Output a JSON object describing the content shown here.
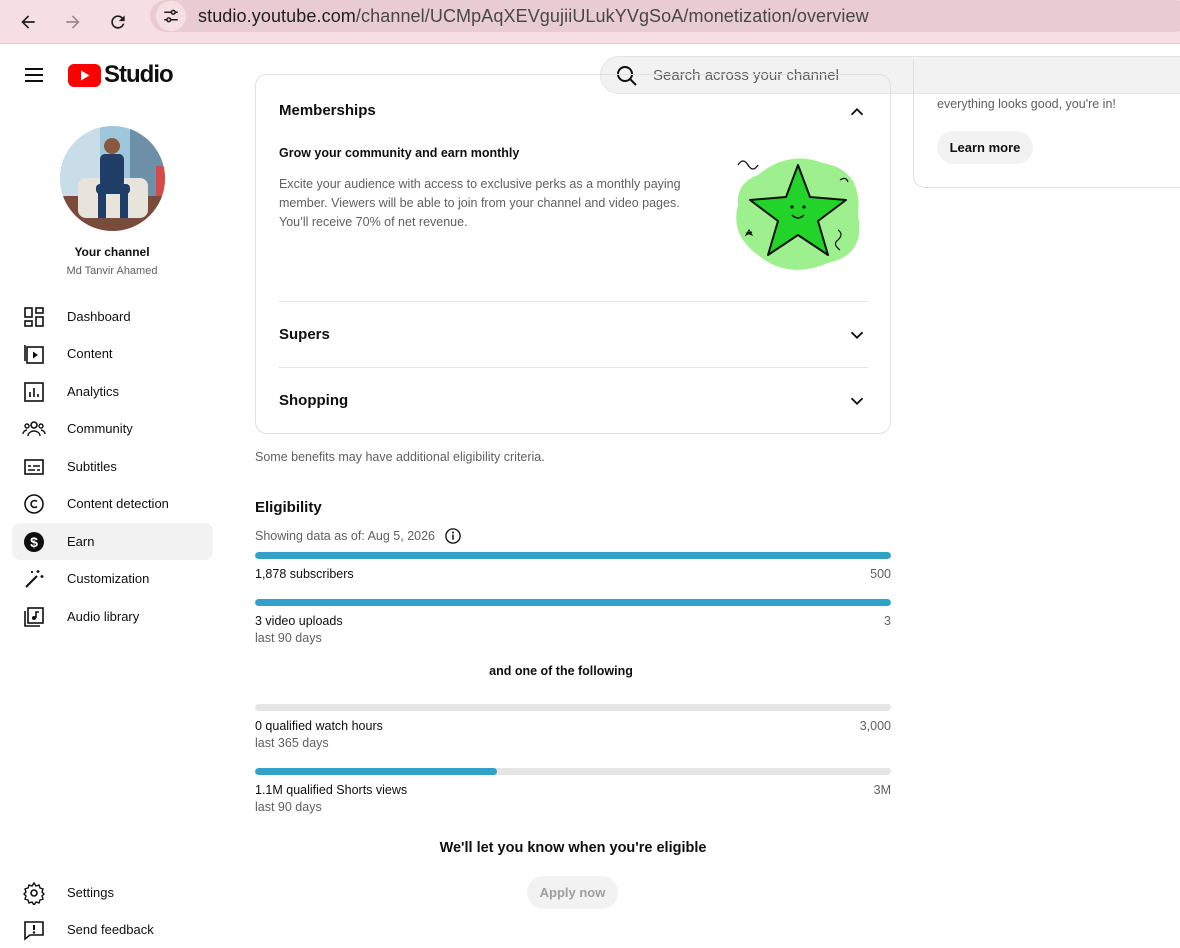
{
  "browser": {
    "url": "studio.youtube.com",
    "url_path": "/channel/UCMpAqXEVgujiiULukYVgSoA/monetization/overview"
  },
  "header": {
    "logo_text": "Studio",
    "search_placeholder": "Search across your channel"
  },
  "sidebar": {
    "channel_title": "Your channel",
    "channel_name": "Md Tanvir Ahamed",
    "items": [
      {
        "label": "Dashboard",
        "icon": "dashboard-icon"
      },
      {
        "label": "Content",
        "icon": "content-icon"
      },
      {
        "label": "Analytics",
        "icon": "analytics-icon"
      },
      {
        "label": "Community",
        "icon": "community-icon"
      },
      {
        "label": "Subtitles",
        "icon": "subtitles-icon"
      },
      {
        "label": "Content detection",
        "icon": "copyright-icon"
      },
      {
        "label": "Earn",
        "icon": "dollar-icon",
        "active": true
      },
      {
        "label": "Customization",
        "icon": "magic-wand-icon"
      },
      {
        "label": "Audio library",
        "icon": "audio-library-icon"
      }
    ],
    "bottom": [
      {
        "label": "Settings",
        "icon": "gear-icon"
      },
      {
        "label": "Send feedback",
        "icon": "feedback-icon"
      }
    ]
  },
  "benefits": {
    "memberships": {
      "title": "Memberships",
      "subtitle": "Grow your community and earn monthly",
      "description": "Excite your audience with access to exclusive perks as a monthly paying member. Viewers will be able to join from your channel and video pages. You’ll receive 70% of net revenue."
    },
    "supers": {
      "title": "Supers"
    },
    "shopping": {
      "title": "Shopping"
    },
    "note": "Some benefits may have additional eligibility criteria."
  },
  "eligibility": {
    "title": "Eligibility",
    "as_of": "Showing data as of: Aug 5, 2026",
    "subscribers": {
      "label": "1,878 subscribers",
      "target": "500",
      "progress": 1.0
    },
    "uploads": {
      "label": "3 video uploads",
      "sub": "last 90 days",
      "target": "3",
      "progress": 1.0
    },
    "or_text": "and one of the following",
    "watch_hours": {
      "label": "0 qualified watch hours",
      "sub": "last 365 days",
      "target": "3,000",
      "progress": 0.0
    },
    "shorts_views": {
      "label": "1.1M qualified Shorts views",
      "sub": "last 90 days",
      "target": "3M",
      "progress": 0.38
    },
    "notify_text": "We'll let you know when you're eligible",
    "apply_label": "Apply now"
  },
  "right_panel": {
    "text": "everything looks good, you're in!",
    "learn_more": "Learn more"
  },
  "colors": {
    "brand_red": "#ff0000",
    "progress": "#2fa3c7",
    "star_green": "#22d42a"
  }
}
